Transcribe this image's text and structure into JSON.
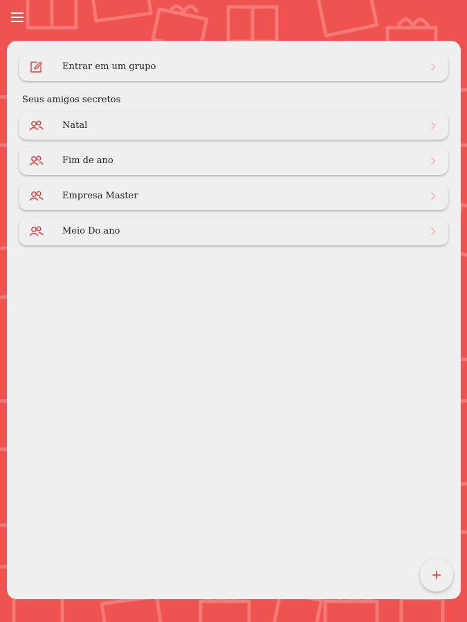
{
  "colors": {
    "background": "#ef5350",
    "panel": "#efefef",
    "accent": "#e53935",
    "text": "#1f1f1f"
  },
  "toolbar": {
    "menu_icon": "hamburger-menu-icon"
  },
  "join_group": {
    "label": "Entrar em um grupo",
    "icon": "edit-box-icon"
  },
  "section": {
    "title": "Seus amigos secretos"
  },
  "groups": [
    {
      "label": "Natal",
      "icon": "people-icon"
    },
    {
      "label": "Fim de ano",
      "icon": "people-icon"
    },
    {
      "label": "Empresa Master",
      "icon": "people-icon"
    },
    {
      "label": "Meio Do ano",
      "icon": "people-icon"
    }
  ],
  "fab": {
    "icon": "plus-icon"
  }
}
